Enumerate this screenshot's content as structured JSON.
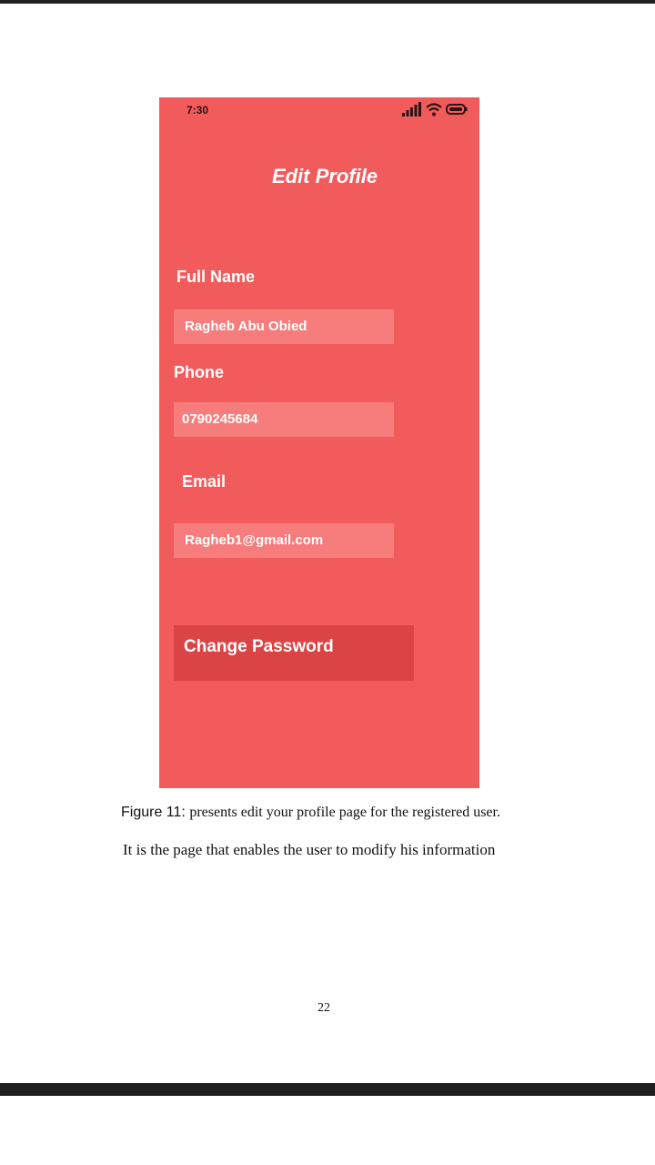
{
  "status_bar": {
    "time": "7:30"
  },
  "screen": {
    "title": "Edit Profile",
    "fields": [
      {
        "label": "Full Name",
        "value": "Ragheb Abu Obied"
      },
      {
        "label": "Phone",
        "value": "0790245684"
      },
      {
        "label": "Email",
        "value": "Ragheb1@gmail.com"
      }
    ],
    "change_password_label": "Change Password"
  },
  "caption": {
    "figure_label": "Figure 11:",
    "figure_text": "presents edit your profile page for the registered user."
  },
  "body_text": "It is the page that enables the user to modify his information",
  "page_number": "22",
  "colors": {
    "screen_background": "#f25b5b",
    "input_background": "#f77d7d",
    "button_background": "#db4444"
  }
}
